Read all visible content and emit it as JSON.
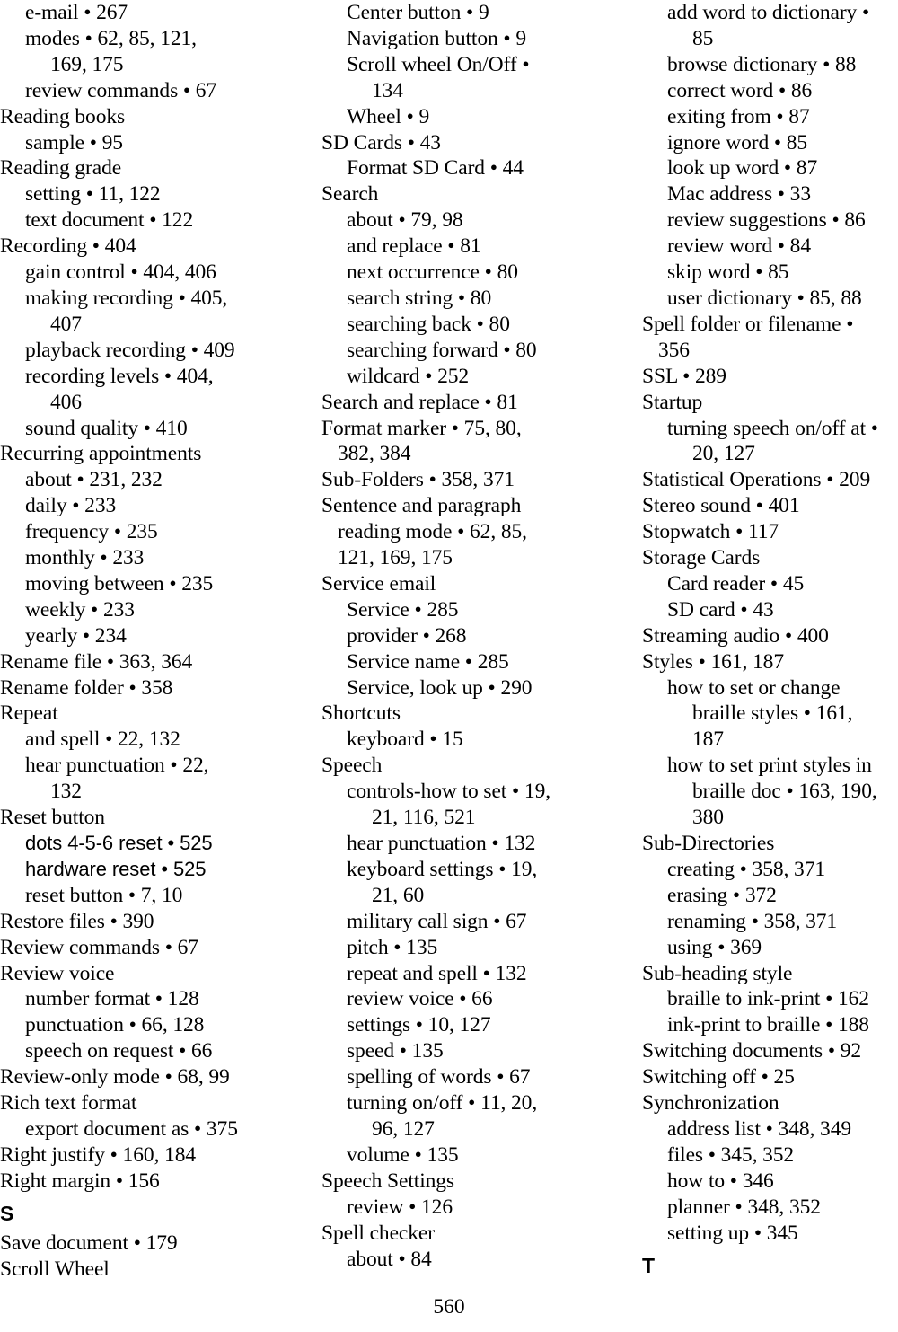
{
  "document": {
    "kind": "book-index",
    "page_number": "560"
  },
  "columns": [
    {
      "id": "column-1",
      "lines": [
        {
          "text": "e-mail • 267",
          "level": "lvl1",
          "style": "serif"
        },
        {
          "text": "modes • 62, 85, 121,",
          "level": "lvl1",
          "style": "serif"
        },
        {
          "text": "169, 175",
          "level": "lvl1w",
          "style": "serif"
        },
        {
          "text": "review commands • 67",
          "level": "lvl1",
          "style": "serif"
        },
        {
          "text": "Reading books",
          "level": "lvl0",
          "style": "serif"
        },
        {
          "text": "sample • 95",
          "level": "lvl1",
          "style": "serif"
        },
        {
          "text": "Reading grade",
          "level": "lvl0",
          "style": "serif"
        },
        {
          "text": "setting • 11, 122",
          "level": "lvl1",
          "style": "serif"
        },
        {
          "text": "text document • 122",
          "level": "lvl1",
          "style": "serif"
        },
        {
          "text": "Recording • 404",
          "level": "lvl0",
          "style": "serif"
        },
        {
          "text": "gain control • 404, 406",
          "level": "lvl1",
          "style": "serif"
        },
        {
          "text": "making recording • 405,",
          "level": "lvl1",
          "style": "serif"
        },
        {
          "text": "407",
          "level": "lvl1w",
          "style": "serif"
        },
        {
          "text": "playback recording • 409",
          "level": "lvl1",
          "style": "serif"
        },
        {
          "text": "recording levels • 404,",
          "level": "lvl1",
          "style": "serif"
        },
        {
          "text": "406",
          "level": "lvl1w",
          "style": "serif"
        },
        {
          "text": "sound quality • 410",
          "level": "lvl1",
          "style": "serif"
        },
        {
          "text": "Recurring appointments",
          "level": "lvl0",
          "style": "serif"
        },
        {
          "text": "about • 231, 232",
          "level": "lvl1",
          "style": "serif"
        },
        {
          "text": "daily • 233",
          "level": "lvl1",
          "style": "serif"
        },
        {
          "text": "frequency • 235",
          "level": "lvl1",
          "style": "serif"
        },
        {
          "text": "monthly • 233",
          "level": "lvl1",
          "style": "serif"
        },
        {
          "text": "moving between • 235",
          "level": "lvl1",
          "style": "serif"
        },
        {
          "text": "weekly • 233",
          "level": "lvl1",
          "style": "serif"
        },
        {
          "text": "yearly • 234",
          "level": "lvl1",
          "style": "serif"
        },
        {
          "text": "Rename file • 363, 364",
          "level": "lvl0",
          "style": "serif"
        },
        {
          "text": "Rename folder • 358",
          "level": "lvl0",
          "style": "serif"
        },
        {
          "text": "Repeat",
          "level": "lvl0",
          "style": "serif"
        },
        {
          "text": "and spell • 22, 132",
          "level": "lvl1",
          "style": "serif"
        },
        {
          "text": "hear punctuation • 22,",
          "level": "lvl1",
          "style": "serif"
        },
        {
          "text": "132",
          "level": "lvl1w",
          "style": "serif"
        },
        {
          "text": "Reset button",
          "level": "lvl0",
          "style": "serif"
        },
        {
          "text": "dots 4-5-6 reset • 525",
          "level": "lvl1",
          "style": "sans"
        },
        {
          "text": "hardware reset • 525",
          "level": "lvl1",
          "style": "sans"
        },
        {
          "text": "reset button • 7, 10",
          "level": "lvl1",
          "style": "serif"
        },
        {
          "text": "Restore files • 390",
          "level": "lvl0",
          "style": "serif"
        },
        {
          "text": "Review commands • 67",
          "level": "lvl0",
          "style": "serif"
        },
        {
          "text": "Review voice",
          "level": "lvl0",
          "style": "serif"
        },
        {
          "text": "number format • 128",
          "level": "lvl1",
          "style": "serif"
        },
        {
          "text": "punctuation • 66, 128",
          "level": "lvl1",
          "style": "serif"
        },
        {
          "text": "speech on request • 66",
          "level": "lvl1",
          "style": "serif"
        },
        {
          "text": "Review-only mode • 68, 99",
          "level": "lvl0",
          "style": "serif"
        },
        {
          "text": "Rich text format",
          "level": "lvl0",
          "style": "serif"
        },
        {
          "text": "export document as • 375",
          "level": "lvl1",
          "style": "serif"
        },
        {
          "text": "Right justify • 160, 184",
          "level": "lvl0",
          "style": "serif"
        },
        {
          "text": "Right margin • 156",
          "level": "lvl0",
          "style": "serif"
        },
        {
          "text": "S",
          "level": "lvl0",
          "style": "letter"
        },
        {
          "text": "Save document • 179",
          "level": "lvl0",
          "style": "serif"
        },
        {
          "text": "Scroll Wheel",
          "level": "lvl0",
          "style": "serif"
        }
      ]
    },
    {
      "id": "column-2",
      "lines": [
        {
          "text": "Center button • 9",
          "level": "lvl1",
          "style": "serif"
        },
        {
          "text": "Navigation button • 9",
          "level": "lvl1",
          "style": "serif"
        },
        {
          "text": "Scroll wheel On/Off •",
          "level": "lvl1",
          "style": "serif"
        },
        {
          "text": "134",
          "level": "lvl1w",
          "style": "serif"
        },
        {
          "text": "Wheel • 9",
          "level": "lvl1",
          "style": "serif"
        },
        {
          "text": "SD Cards • 43",
          "level": "lvl0",
          "style": "serif"
        },
        {
          "text": "Format SD Card • 44",
          "level": "lvl1",
          "style": "serif"
        },
        {
          "text": "Search",
          "level": "lvl0",
          "style": "serif"
        },
        {
          "text": "about • 79, 98",
          "level": "lvl1",
          "style": "serif"
        },
        {
          "text": "and replace • 81",
          "level": "lvl1",
          "style": "serif"
        },
        {
          "text": "next occurrence • 80",
          "level": "lvl1",
          "style": "serif"
        },
        {
          "text": "search string • 80",
          "level": "lvl1",
          "style": "serif"
        },
        {
          "text": "searching back • 80",
          "level": "lvl1",
          "style": "serif"
        },
        {
          "text": "searching forward • 80",
          "level": "lvl1",
          "style": "serif"
        },
        {
          "text": "wildcard • 252",
          "level": "lvl1",
          "style": "serif"
        },
        {
          "text": "Search and replace • 81",
          "level": "lvl0",
          "style": "serif"
        },
        {
          "text": "Format marker • 75, 80,",
          "level": "lvl0",
          "style": "serif"
        },
        {
          "text": "382, 384",
          "level": "lvl0w",
          "style": "serif"
        },
        {
          "text": "Sub-Folders • 358, 371",
          "level": "lvl0",
          "style": "serif"
        },
        {
          "text": "Sentence and paragraph",
          "level": "lvl0",
          "style": "serif"
        },
        {
          "text": "reading mode • 62, 85,",
          "level": "lvl0w",
          "style": "serif"
        },
        {
          "text": "121, 169, 175",
          "level": "lvl0w",
          "style": "serif"
        },
        {
          "text": "Service email",
          "level": "lvl0",
          "style": "serif"
        },
        {
          "text": "Service • 285",
          "level": "lvl1",
          "style": "serif"
        },
        {
          "text": "provider • 268",
          "level": "lvl1",
          "style": "serif"
        },
        {
          "text": "Service name • 285",
          "level": "lvl1",
          "style": "serif"
        },
        {
          "text": "Service, look up • 290",
          "level": "lvl1",
          "style": "serif"
        },
        {
          "text": "Shortcuts",
          "level": "lvl0",
          "style": "serif"
        },
        {
          "text": "keyboard • 15",
          "level": "lvl1",
          "style": "serif"
        },
        {
          "text": "Speech",
          "level": "lvl0",
          "style": "serif"
        },
        {
          "text": "controls-how to set • 19,",
          "level": "lvl1",
          "style": "serif"
        },
        {
          "text": "21, 116, 521",
          "level": "lvl1w",
          "style": "serif"
        },
        {
          "text": "hear punctuation • 132",
          "level": "lvl1",
          "style": "serif"
        },
        {
          "text": "keyboard settings • 19,",
          "level": "lvl1",
          "style": "serif"
        },
        {
          "text": "21, 60",
          "level": "lvl1w",
          "style": "serif"
        },
        {
          "text": "military call sign • 67",
          "level": "lvl1",
          "style": "serif"
        },
        {
          "text": "pitch • 135",
          "level": "lvl1",
          "style": "serif"
        },
        {
          "text": "repeat and spell • 132",
          "level": "lvl1",
          "style": "serif"
        },
        {
          "text": "review voice • 66",
          "level": "lvl1",
          "style": "serif"
        },
        {
          "text": "settings • 10, 127",
          "level": "lvl1",
          "style": "serif"
        },
        {
          "text": "speed • 135",
          "level": "lvl1",
          "style": "serif"
        },
        {
          "text": "spelling of words • 67",
          "level": "lvl1",
          "style": "serif"
        },
        {
          "text": "turning on/off • 11, 20,",
          "level": "lvl1",
          "style": "serif"
        },
        {
          "text": "96, 127",
          "level": "lvl1w",
          "style": "serif"
        },
        {
          "text": "volume • 135",
          "level": "lvl1",
          "style": "serif"
        },
        {
          "text": "Speech Settings",
          "level": "lvl0",
          "style": "serif"
        },
        {
          "text": "review • 126",
          "level": "lvl1",
          "style": "serif"
        },
        {
          "text": "Spell checker",
          "level": "lvl0",
          "style": "serif"
        },
        {
          "text": "about • 84",
          "level": "lvl1",
          "style": "serif"
        }
      ]
    },
    {
      "id": "column-3",
      "lines": [
        {
          "text": "add word to dictionary •",
          "level": "lvl1",
          "style": "serif"
        },
        {
          "text": "85",
          "level": "lvl1w",
          "style": "serif"
        },
        {
          "text": "browse dictionary • 88",
          "level": "lvl1",
          "style": "serif"
        },
        {
          "text": "correct word • 86",
          "level": "lvl1",
          "style": "serif"
        },
        {
          "text": "exiting from • 87",
          "level": "lvl1",
          "style": "serif"
        },
        {
          "text": "ignore word • 85",
          "level": "lvl1",
          "style": "serif"
        },
        {
          "text": "look up word • 87",
          "level": "lvl1",
          "style": "serif"
        },
        {
          "text": "Mac address • 33",
          "level": "lvl1",
          "style": "serif"
        },
        {
          "text": "review suggestions • 86",
          "level": "lvl1",
          "style": "serif"
        },
        {
          "text": "review word • 84",
          "level": "lvl1",
          "style": "serif"
        },
        {
          "text": "skip word • 85",
          "level": "lvl1",
          "style": "serif"
        },
        {
          "text": "user dictionary • 85, 88",
          "level": "lvl1",
          "style": "serif"
        },
        {
          "text": "Spell folder or filename •",
          "level": "lvl0",
          "style": "serif"
        },
        {
          "text": "356",
          "level": "lvl0w",
          "style": "serif"
        },
        {
          "text": "SSL • 289",
          "level": "lvl0",
          "style": "serif"
        },
        {
          "text": "Startup",
          "level": "lvl0",
          "style": "serif"
        },
        {
          "text": "turning speech on/off at •",
          "level": "lvl1",
          "style": "serif"
        },
        {
          "text": "20, 127",
          "level": "lvl1w",
          "style": "serif"
        },
        {
          "text": "Statistical Operations • 209",
          "level": "lvl0",
          "style": "serif"
        },
        {
          "text": "Stereo sound • 401",
          "level": "lvl0",
          "style": "serif"
        },
        {
          "text": "Stopwatch • 117",
          "level": "lvl0",
          "style": "serif"
        },
        {
          "text": "Storage Cards",
          "level": "lvl0",
          "style": "serif"
        },
        {
          "text": "Card reader • 45",
          "level": "lvl1",
          "style": "serif"
        },
        {
          "text": "SD card • 43",
          "level": "lvl1",
          "style": "serif"
        },
        {
          "text": "Streaming audio • 400",
          "level": "lvl0",
          "style": "serif"
        },
        {
          "text": "Styles • 161, 187",
          "level": "lvl0",
          "style": "serif"
        },
        {
          "text": "how to set or change",
          "level": "lvl1",
          "style": "serif"
        },
        {
          "text": "braille styles • 161,",
          "level": "lvl2",
          "style": "serif"
        },
        {
          "text": "187",
          "level": "lvl2",
          "style": "serif"
        },
        {
          "text": "how to set print styles in",
          "level": "lvl1",
          "style": "serif"
        },
        {
          "text": "braille doc • 163, 190,",
          "level": "lvl2",
          "style": "serif"
        },
        {
          "text": "380",
          "level": "lvl2",
          "style": "serif"
        },
        {
          "text": "Sub-Directories",
          "level": "lvl0",
          "style": "serif"
        },
        {
          "text": "creating • 358, 371",
          "level": "lvl1",
          "style": "serif"
        },
        {
          "text": "erasing • 372",
          "level": "lvl1",
          "style": "serif"
        },
        {
          "text": "renaming • 358, 371",
          "level": "lvl1",
          "style": "serif"
        },
        {
          "text": "using • 369",
          "level": "lvl1",
          "style": "serif"
        },
        {
          "text": "Sub-heading style",
          "level": "lvl0",
          "style": "serif"
        },
        {
          "text": "braille to ink-print • 162",
          "level": "lvl1",
          "style": "serif"
        },
        {
          "text": "ink-print to braille • 188",
          "level": "lvl1",
          "style": "serif"
        },
        {
          "text": "Switching documents • 92",
          "level": "lvl0",
          "style": "serif"
        },
        {
          "text": "Switching off • 25",
          "level": "lvl0",
          "style": "serif"
        },
        {
          "text": "Synchronization",
          "level": "lvl0",
          "style": "serif"
        },
        {
          "text": "address list • 348, 349",
          "level": "lvl1",
          "style": "serif"
        },
        {
          "text": "files • 345, 352",
          "level": "lvl1",
          "style": "serif"
        },
        {
          "text": "how to • 346",
          "level": "lvl1",
          "style": "serif"
        },
        {
          "text": "planner • 348, 352",
          "level": "lvl1",
          "style": "serif"
        },
        {
          "text": "setting up • 345",
          "level": "lvl1",
          "style": "serif"
        },
        {
          "text": "T",
          "level": "lvl0",
          "style": "letter"
        }
      ]
    }
  ]
}
